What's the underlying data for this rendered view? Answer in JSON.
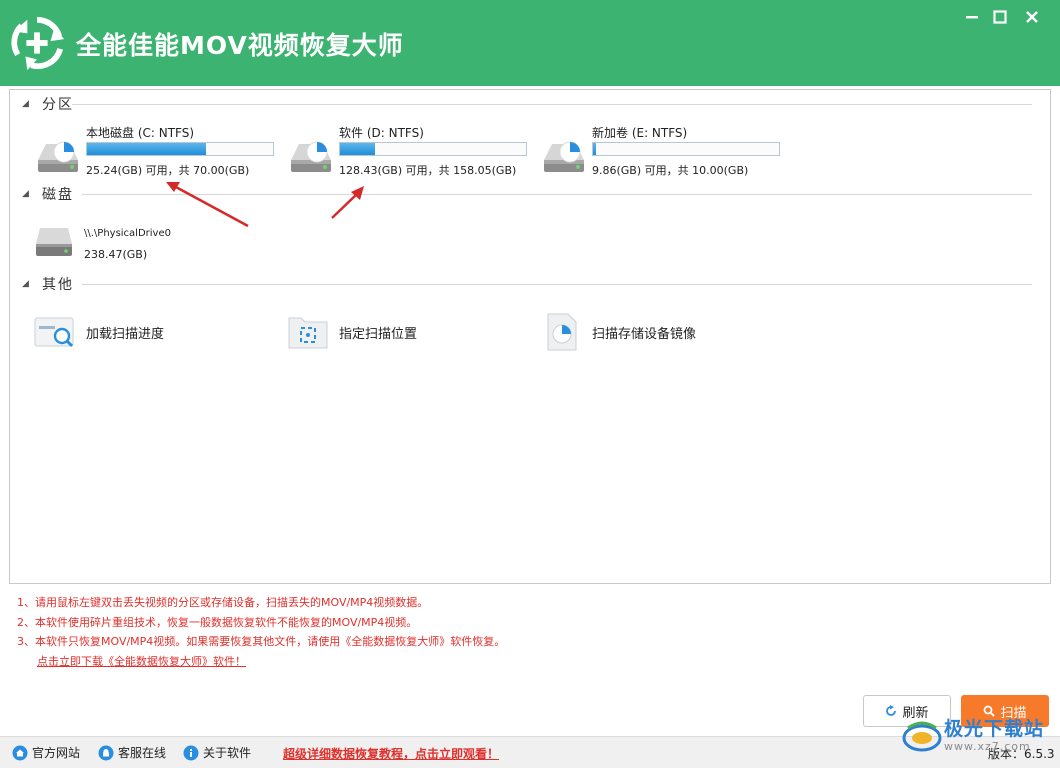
{
  "app": {
    "title": "全能佳能MOV视频恢复大师",
    "accent": "#3cb371"
  },
  "window_controls": [
    "minimize-icon",
    "maximize-icon",
    "close-icon"
  ],
  "sections": {
    "partitions": "分区",
    "disks": "磁盘",
    "other": "其他"
  },
  "partitions": [
    {
      "name": "本地磁盘 (C: NTFS)",
      "info": "25.24(GB) 可用，共 70.00(GB)",
      "used_fraction": 0.64
    },
    {
      "name": "软件 (D: NTFS)",
      "info": "128.43(GB) 可用，共 158.05(GB)",
      "used_fraction": 0.19
    },
    {
      "name": "新加卷 (E: NTFS)",
      "info": "9.86(GB) 可用，共 10.00(GB)",
      "used_fraction": 0.01
    }
  ],
  "disks": [
    {
      "name": "\\\\.\\PhysicalDrive0",
      "size": "238.47(GB)"
    }
  ],
  "tools": [
    {
      "label": "加载扫描进度",
      "icon": "load-progress-icon"
    },
    {
      "label": "指定扫描位置",
      "icon": "folder-target-icon"
    },
    {
      "label": "扫描存储设备镜像",
      "icon": "disk-image-icon"
    }
  ],
  "notes": [
    "1、请用鼠标左键双击丢失视频的分区或存储设备，扫描丢失的MOV/MP4视频数据。",
    "2、本软件使用碎片重组技术，恢复一般数据恢复软件不能恢复的MOV/MP4视频。",
    "3、本软件只恢复MOV/MP4视频。如果需要恢复其他文件，请使用《全能数据恢复大师》软件恢复。"
  ],
  "download_link": "点击立即下载《全能数据恢复大师》软件！",
  "buttons": {
    "refresh": "刷新",
    "scan": "扫描",
    "scan_color": "#f77a2a"
  },
  "statusbar": {
    "website": "官方网站",
    "service": "客服在线",
    "about": "关于软件",
    "tutorial": "超级详细数据恢复教程，点击立即观看！",
    "version": "版本：6.5.3"
  },
  "watermark": {
    "text": "极光下载站",
    "sub": "www.xz7.com"
  }
}
